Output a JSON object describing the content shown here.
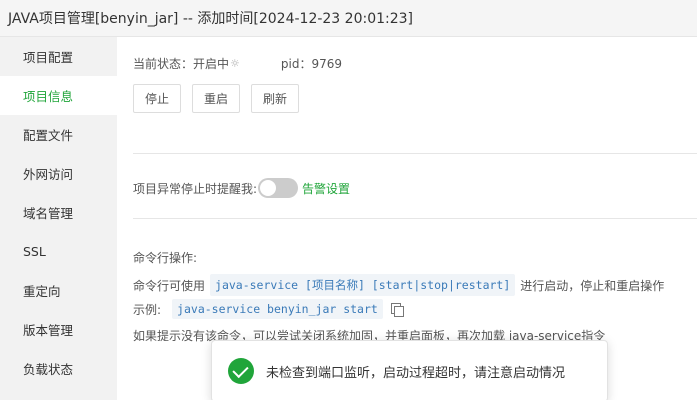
{
  "window": {
    "title": "JAVA项目管理[benyin_jar] -- 添加时间[2024-12-23 20:01:23]"
  },
  "sidebar": {
    "items": [
      {
        "label": "项目配置",
        "active": false
      },
      {
        "label": "项目信息",
        "active": true
      },
      {
        "label": "配置文件",
        "active": false
      },
      {
        "label": "外网访问",
        "active": false
      },
      {
        "label": "域名管理",
        "active": false
      },
      {
        "label": "SSL",
        "active": false
      },
      {
        "label": "重定向",
        "active": false
      },
      {
        "label": "版本管理",
        "active": false
      },
      {
        "label": "负载状态",
        "active": false
      }
    ]
  },
  "status": {
    "state_label": "当前状态：",
    "state_value": "开启中",
    "spinner_glyph": "☼",
    "pid_label": "pid：",
    "pid_value": "9769"
  },
  "buttons": {
    "stop": "停止",
    "restart": "重启",
    "refresh": "刷新"
  },
  "alarm": {
    "label": "项目异常停止时提醒我:",
    "toggle_on": false,
    "link": "告警设置"
  },
  "cli": {
    "title": "命令行操作:",
    "usage_prefix": "命令行可使用",
    "usage_code": "java-service [项目名称] [start|stop|restart]",
    "usage_suffix": "进行启动，停止和重启操作",
    "example_label": "示例:",
    "example_code": "java-service benyin_jar start",
    "note": "如果提示没有该命令，可以尝试关闭系统加固，并重启面板，再次加载 java-service指令"
  },
  "toast": {
    "message": "未检查到端口监听，启动过程超时，请注意启动情况"
  },
  "colors": {
    "accent": "#20a53a",
    "code_text": "#3a7ab8"
  }
}
